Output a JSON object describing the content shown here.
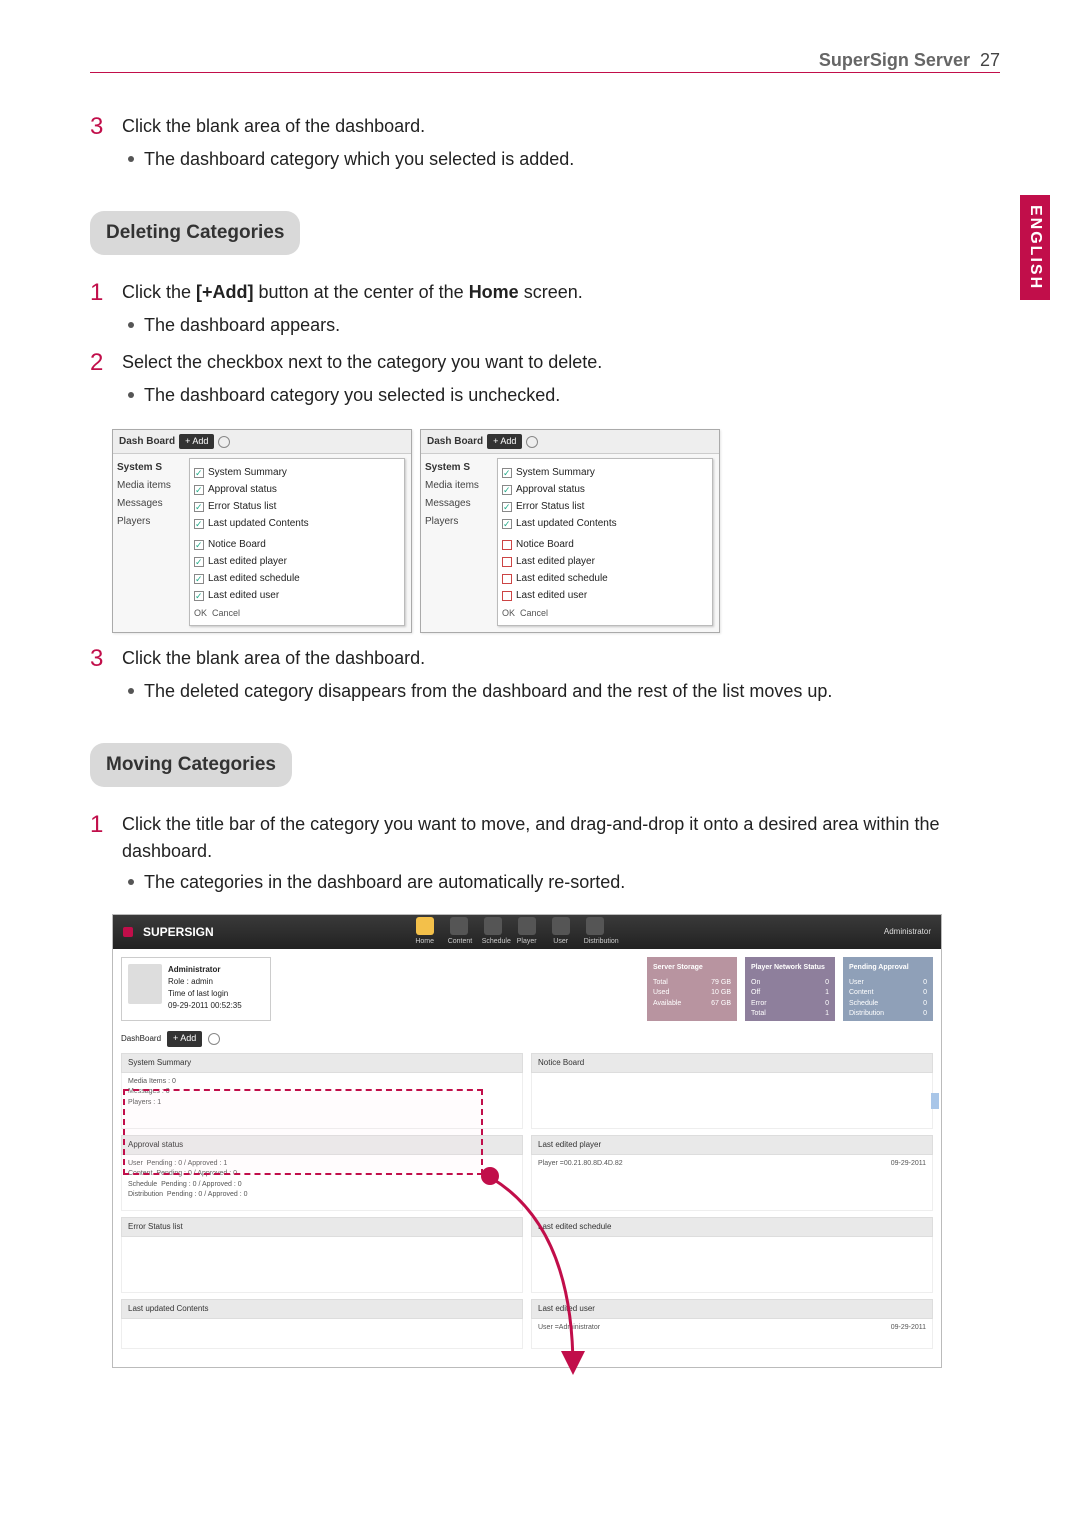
{
  "header": {
    "title": "SuperSign Server",
    "page_number": "27"
  },
  "language_tab": "ENGLISH",
  "section_a": {
    "step3_text": "Click the blank area of the dashboard.",
    "step3_bullet": "The dashboard category which you selected is added."
  },
  "deleting": {
    "title": "Deleting Categories",
    "step1": "Click the [+Add] button at the center of the Home screen.",
    "step1_prefix": "Click the ",
    "step1_bold1": "[+Add]",
    "step1_mid": " button at the center of the ",
    "step1_bold2": "Home",
    "step1_suffix": " screen.",
    "step1_bullet": "The dashboard appears.",
    "step2": "Select the checkbox next to the category you want to delete.",
    "step2_bullet": "The dashboard category you selected is unchecked.",
    "step3": "Click the blank area of the dashboard.",
    "step3_bullet": "The deleted category disappears from the dashboard and the rest of the list moves up."
  },
  "moving": {
    "title": "Moving Categories",
    "step1": "Click the title bar of the category you want to move, and drag-and-drop it onto a desired area within the dashboard.",
    "step1_bullet": "The categories in the dashboard are automatically re-sorted."
  },
  "panel_common": {
    "dashboard_label": "Dash Board",
    "add_btn": "+ Add",
    "ok": "OK",
    "cancel": "Cancel",
    "side": {
      "system": "System S",
      "media": "Media items",
      "messages": "Messages",
      "players": "Players"
    },
    "opts": {
      "sys_summary": "System Summary",
      "approval": "Approval status",
      "error_list": "Error Status list",
      "last_updated_contents": "Last updated Contents",
      "notice": "Notice Board",
      "last_player": "Last edited player",
      "last_schedule": "Last edited schedule",
      "last_user": "Last edited user"
    }
  },
  "app": {
    "brand": "SUPERSIGN",
    "nav": {
      "home": "Home",
      "content": "Content",
      "schedule": "Schedule",
      "player": "Player",
      "user": "User",
      "distribution": "Distribution"
    },
    "header_right": "Administrator",
    "admin": {
      "title": "Administrator",
      "role_label": "Role",
      "role_value": "admin",
      "time_login_label": "Time of last login",
      "time_login_value": "09-29-2011 00:52:35"
    },
    "stat1": {
      "title": "Server Storage",
      "rows": [
        [
          "Total",
          "79 GB"
        ],
        [
          "Used",
          "10 GB"
        ],
        [
          "Available",
          "67 GB"
        ]
      ]
    },
    "stat2": {
      "title": "Player Network Status",
      "rows": [
        [
          "On",
          "0"
        ],
        [
          "Off",
          "1"
        ],
        [
          "Error",
          "0"
        ],
        [
          "Total",
          "1"
        ]
      ]
    },
    "stat3": {
      "title": "Pending Approval",
      "rows": [
        [
          "User",
          "0"
        ],
        [
          "Content",
          "0"
        ],
        [
          "Schedule",
          "0"
        ],
        [
          "Distribution",
          "0"
        ]
      ]
    },
    "dashbar": {
      "label": "DashBoard",
      "add": "+ Add"
    },
    "sections": {
      "sys_summary": "System Summary",
      "sys_body": [
        [
          "Media Items",
          "0"
        ],
        [
          "Messages",
          "0"
        ],
        [
          "Players",
          "1"
        ]
      ],
      "approval": "Approval status",
      "approval_rows": [
        [
          "User",
          "Pending : 0",
          "/",
          "Approved : 1"
        ],
        [
          "Content",
          "Pending : 0",
          "/",
          "Approved : 0"
        ],
        [
          "Schedule",
          "Pending : 0",
          "/",
          "Approved : 0"
        ],
        [
          "Distribution",
          "Pending : 0",
          "/",
          "Approved : 0"
        ]
      ],
      "error_list": "Error Status list",
      "last_updated_contents": "Last updated Contents",
      "notice": "Notice Board",
      "last_player_hdr": "Last edited player",
      "last_player_row": "Player =00.21.80.8D.4D.82",
      "last_player_date": "09-29-2011",
      "last_schedule": "Last edited schedule",
      "last_user_hdr": "Last edited user",
      "last_user_row": "User =Administrator",
      "last_user_date": "09-29-2011"
    }
  }
}
